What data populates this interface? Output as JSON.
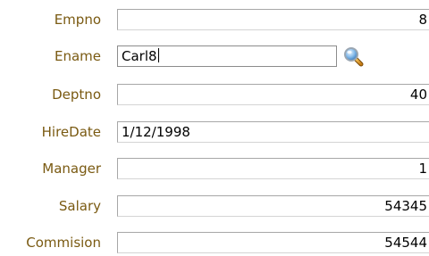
{
  "form": {
    "fields": [
      {
        "label": "Empno",
        "value": "8"
      },
      {
        "label": "Ename",
        "value": "Carl8"
      },
      {
        "label": "Deptno",
        "value": "40"
      },
      {
        "label": "HireDate",
        "value": "1/12/1998"
      },
      {
        "label": "Manager",
        "value": "1"
      },
      {
        "label": "Salary",
        "value": "54345"
      },
      {
        "label": "Commision",
        "value": "54544"
      }
    ],
    "icons": {
      "search": "magnifier-icon"
    },
    "colors": {
      "label": "#7a5a12",
      "field_border": "#a7a7a7",
      "background": "#ffffff"
    }
  }
}
